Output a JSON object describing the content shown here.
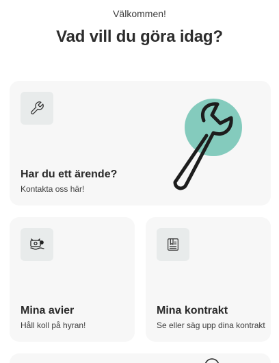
{
  "header": {
    "welcome": "Välkommen!",
    "title": "Vad vill du göra idag?"
  },
  "cards": [
    {
      "id": "errand",
      "icon": "wrench-icon",
      "title": "Har du ett ärende?",
      "subtitle": "Kontakta oss här!",
      "illustration": "wrench-illustration"
    },
    {
      "id": "avier",
      "icon": "money-icon",
      "title": "Mina avier",
      "subtitle": "Håll koll på hyran!"
    },
    {
      "id": "kontrakt",
      "icon": "contract-icon",
      "title": "Mina kontrakt",
      "subtitle": "Se eller säg upp dina kontrakt"
    }
  ],
  "colors": {
    "card_bg": "#f7f7f7",
    "icon_bg": "#e8ebeb",
    "accent_circle": "#84cbbd",
    "text": "#2b2b2b"
  }
}
